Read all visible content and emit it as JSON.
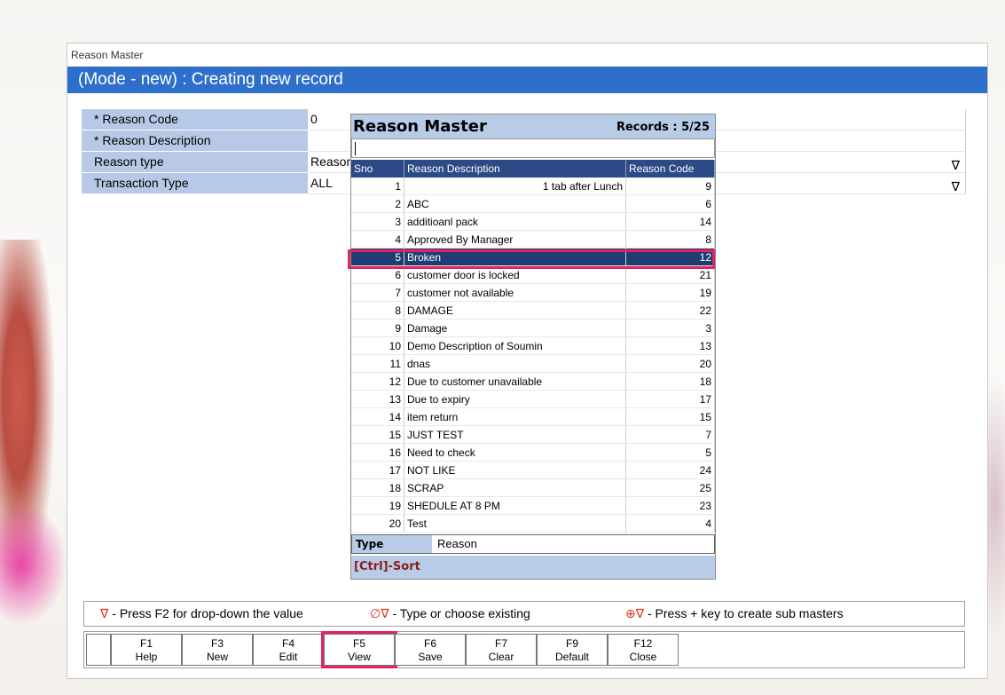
{
  "window": {
    "title": "Reason Master",
    "mode": "(Mode - new) : Creating new record"
  },
  "form": {
    "fields": [
      {
        "label": "* Reason Code",
        "value": "0",
        "dropdown": false
      },
      {
        "label": "* Reason Description",
        "value": "",
        "dropdown": false
      },
      {
        "label": "Reason type",
        "value": "Reason",
        "dropdown": true
      },
      {
        "label": "Transaction Type",
        "value": "ALL",
        "dropdown": true
      }
    ]
  },
  "popup": {
    "title": "Reason Master",
    "records": "Records : 5/25",
    "search_value": "",
    "columns": {
      "sno": "Sno",
      "desc": "Reason Description",
      "code": "Reason Code"
    },
    "rows": [
      {
        "sno": "1",
        "desc": "1 tab after Lunch",
        "code": "9"
      },
      {
        "sno": "2",
        "desc": "ABC",
        "code": "6"
      },
      {
        "sno": "3",
        "desc": "additioanl pack",
        "code": "14"
      },
      {
        "sno": "4",
        "desc": "Approved By Manager",
        "code": "8"
      },
      {
        "sno": "5",
        "desc": "Broken",
        "code": "12"
      },
      {
        "sno": "6",
        "desc": "customer door is locked",
        "code": "21"
      },
      {
        "sno": "7",
        "desc": "customer not available",
        "code": "19"
      },
      {
        "sno": "8",
        "desc": "DAMAGE",
        "code": "22"
      },
      {
        "sno": "9",
        "desc": "Damage",
        "code": "3"
      },
      {
        "sno": "10",
        "desc": "Demo Description of Soumin",
        "code": "13"
      },
      {
        "sno": "11",
        "desc": "dnas",
        "code": "20"
      },
      {
        "sno": "12",
        "desc": "Due to customer unavailable",
        "code": "18"
      },
      {
        "sno": "13",
        "desc": "Due to expiry",
        "code": "17"
      },
      {
        "sno": "14",
        "desc": "item return",
        "code": "15"
      },
      {
        "sno": "15",
        "desc": "JUST TEST",
        "code": "7"
      },
      {
        "sno": "16",
        "desc": "Need to check",
        "code": "5"
      },
      {
        "sno": "17",
        "desc": "NOT LIKE",
        "code": "24"
      },
      {
        "sno": "18",
        "desc": "SCRAP",
        "code": "25"
      },
      {
        "sno": "19",
        "desc": "SHEDULE AT 8 PM",
        "code": "23"
      },
      {
        "sno": "20",
        "desc": "Test",
        "code": "4"
      }
    ],
    "selected_index": 4,
    "type_label": "Type",
    "type_value": "Reason",
    "footer": "[Ctrl]-Sort"
  },
  "legend": {
    "dropdown_sym": "∇",
    "dropdown_text": " - Press F2 for drop-down the value",
    "type_sym": "∅∇",
    "type_text": " - Type or choose existing",
    "sub_sym": "⊕∇",
    "sub_text": " - Press + key to create sub masters"
  },
  "fkeys": [
    {
      "key": "",
      "label": ""
    },
    {
      "key": "F1",
      "label": "Help"
    },
    {
      "key": "F3",
      "label": "New"
    },
    {
      "key": "F4",
      "label": "Edit"
    },
    {
      "key": "F5",
      "label": "View"
    },
    {
      "key": "F6",
      "label": "Save"
    },
    {
      "key": "F7",
      "label": "Clear"
    },
    {
      "key": "F9",
      "label": "Default"
    },
    {
      "key": "F12",
      "label": "Close"
    }
  ],
  "icons": {
    "dropdown": "∇"
  },
  "colors": {
    "mode_bar": "#2f6fcc",
    "label_bg": "#b7c9e6",
    "selected_row": "#1f3c73",
    "highlight": "#e0245e"
  }
}
